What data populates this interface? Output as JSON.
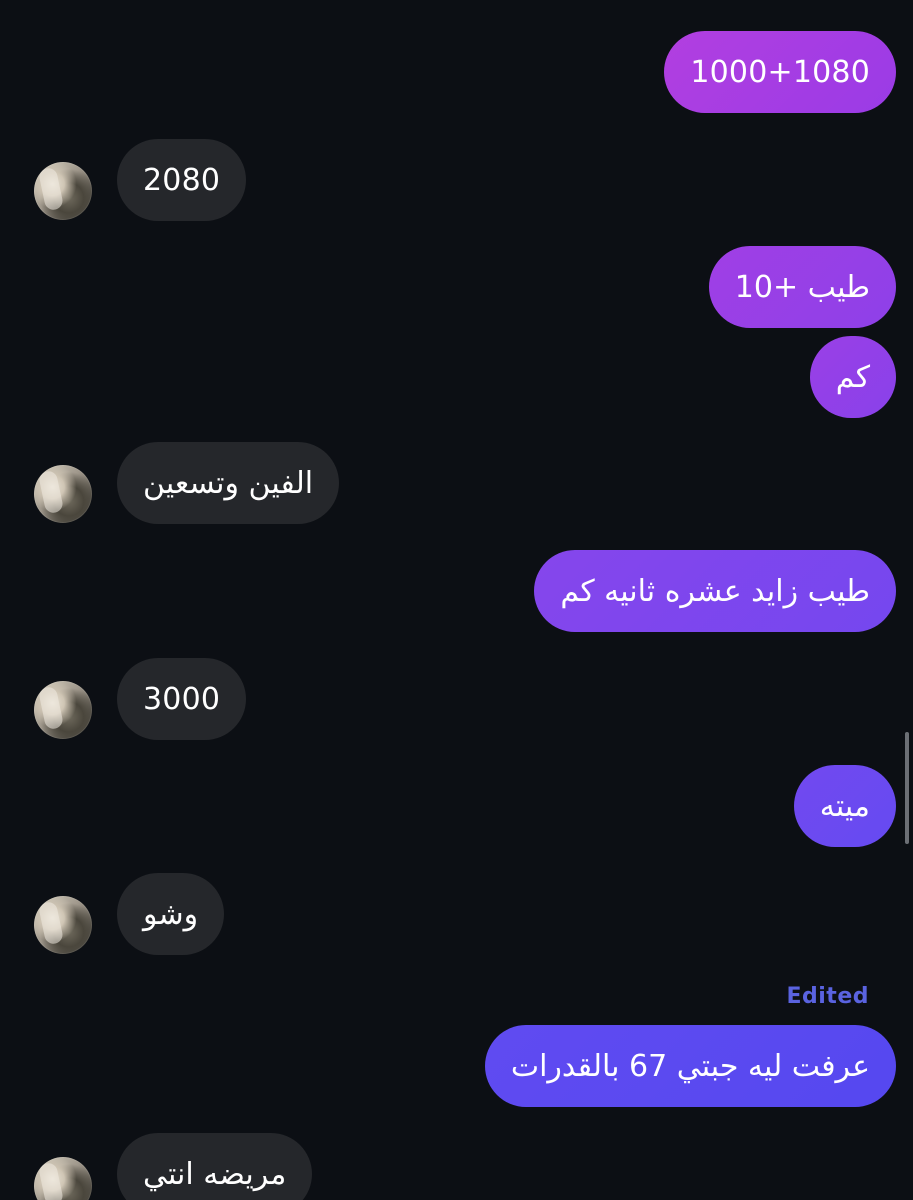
{
  "messages": [
    {
      "side": "out",
      "text": "1000+1080",
      "color": "#a73de3"
    },
    {
      "side": "in",
      "text": "2080"
    },
    {
      "side": "out",
      "text": "طيب +10",
      "color": "#9a3fe6"
    },
    {
      "side": "out",
      "text": "كم",
      "color": "#953fe7"
    },
    {
      "side": "in",
      "text": "الفين وتسعين"
    },
    {
      "side": "out",
      "text": "طيب زايد عشره ثانيه كم",
      "color": "#7f45ee"
    },
    {
      "side": "in",
      "text": "3000"
    },
    {
      "side": "out",
      "text": "ميته",
      "color": "#6c49f0"
    },
    {
      "side": "in",
      "text": "وشو"
    },
    {
      "side": "out",
      "text": "عرفت ليه جبتي 67 بالقدرات",
      "color": "#5a48f0",
      "edited_label": "Edited"
    },
    {
      "side": "in",
      "text": "مريضه انتي"
    }
  ],
  "colors": {
    "background": "#0c0f14",
    "incoming_bubble": "#25272b",
    "edited_label": "#5a63e0"
  }
}
